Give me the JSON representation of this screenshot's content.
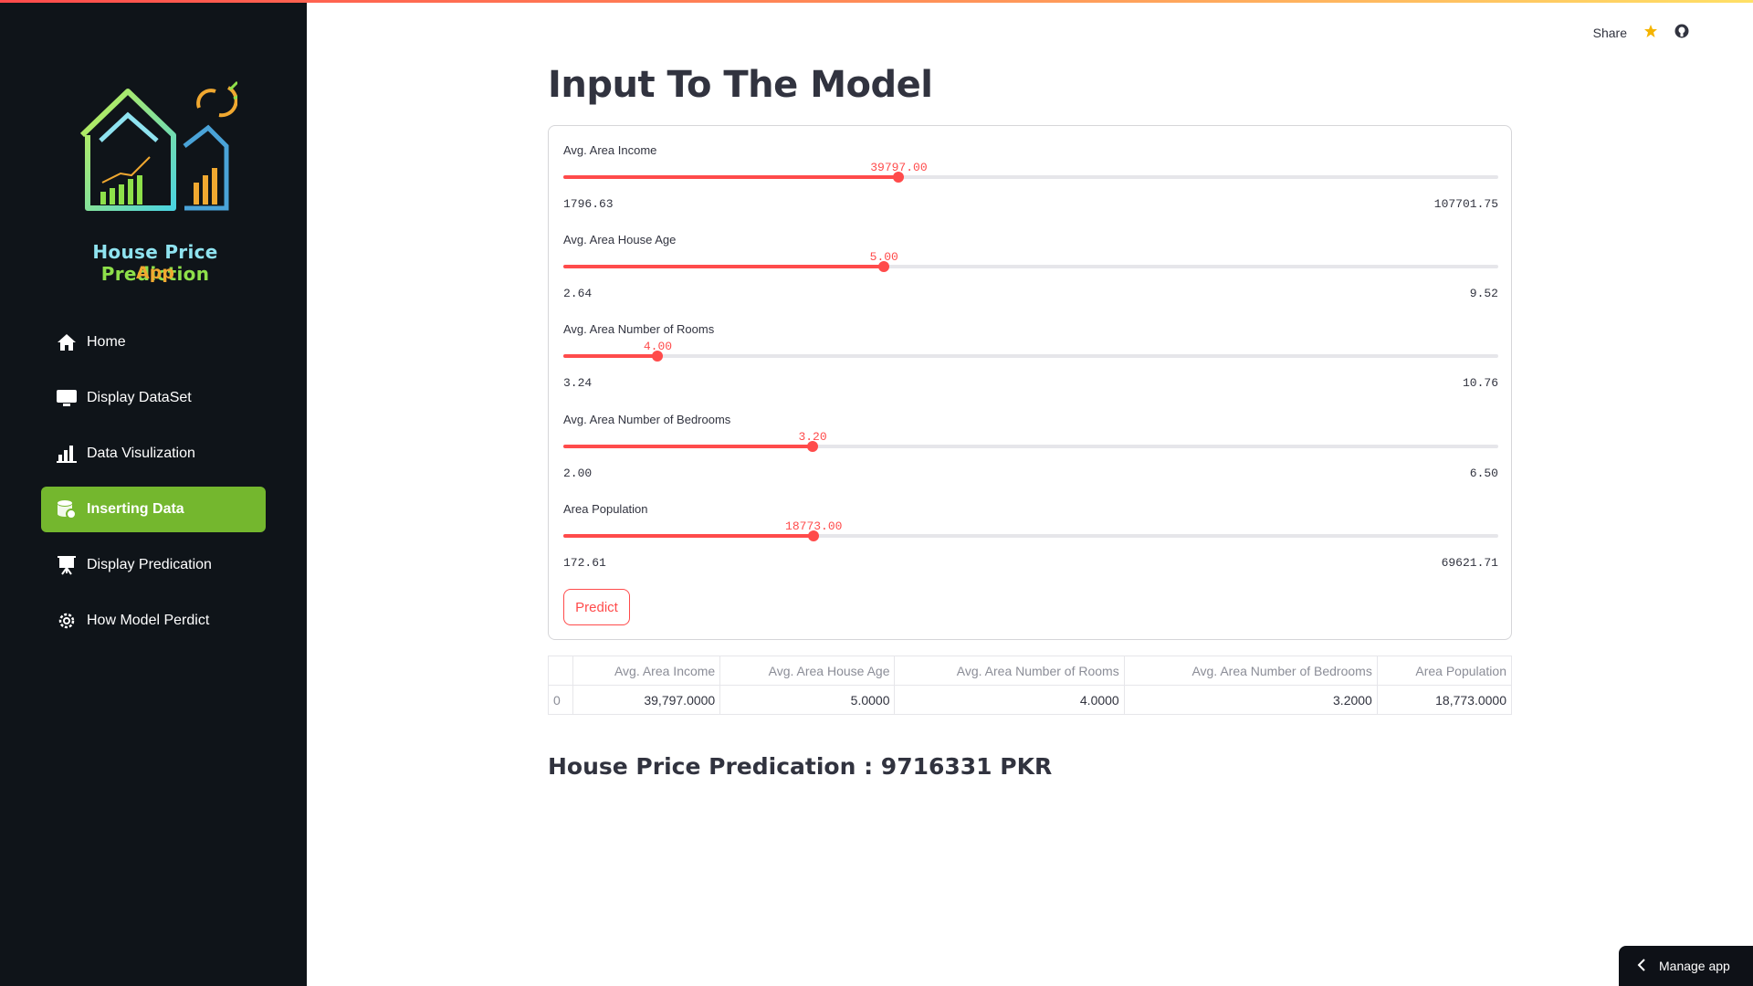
{
  "app": {
    "title_part1": "House Price ",
    "title_part2": "Prediction",
    "title_part3": "App"
  },
  "nav": [
    {
      "label": "Home",
      "icon": "home-icon",
      "active": false
    },
    {
      "label": "Display DataSet",
      "icon": "monitor-icon",
      "active": false
    },
    {
      "label": "Data Visulization",
      "icon": "bar-chart-icon",
      "active": false
    },
    {
      "label": "Inserting Data",
      "icon": "database-icon",
      "active": true
    },
    {
      "label": "Display Predication",
      "icon": "presentation-icon",
      "active": false
    },
    {
      "label": "How Model Perdict",
      "icon": "gear-icon",
      "active": false
    }
  ],
  "header": {
    "share_label": "Share",
    "star_icon": "star-icon",
    "github_icon": "github-icon"
  },
  "page": {
    "title": "Input To The Model"
  },
  "sliders": [
    {
      "label": "Avg. Area Income",
      "value_text": "39797.00",
      "min_text": "1796.63",
      "max_text": "107701.75",
      "value": 39797.0,
      "min": 1796.63,
      "max": 107701.75
    },
    {
      "label": "Avg. Area House Age",
      "value_text": "5.00",
      "min_text": "2.64",
      "max_text": "9.52",
      "value": 5.0,
      "min": 2.64,
      "max": 9.52
    },
    {
      "label": "Avg. Area Number of Rooms",
      "value_text": "4.00",
      "min_text": "3.24",
      "max_text": "10.76",
      "value": 4.0,
      "min": 3.24,
      "max": 10.76
    },
    {
      "label": "Avg. Area Number of Bedrooms",
      "value_text": "3.20",
      "min_text": "2.00",
      "max_text": "6.50",
      "value": 3.2,
      "min": 2.0,
      "max": 6.5
    },
    {
      "label": "Area Population",
      "value_text": "18773.00",
      "min_text": "172.61",
      "max_text": "69621.71",
      "value": 18773.0,
      "min": 172.61,
      "max": 69621.71
    }
  ],
  "predict_label": "Predict",
  "table": {
    "headers": [
      "",
      "Avg. Area Income",
      "Avg. Area House Age",
      "Avg. Area Number of Rooms",
      "Avg. Area Number of Bedrooms",
      "Area Population"
    ],
    "rows": [
      [
        "0",
        "39,797.0000",
        "5.0000",
        "4.0000",
        "3.2000",
        "18,773.0000"
      ]
    ]
  },
  "result_text": "House Price Predication : 9716331 PKR",
  "manage_label": "Manage app",
  "colors": {
    "accent": "#ff4b4b",
    "sidebar_bg": "#0f1419",
    "active_nav": "#74b72e"
  }
}
